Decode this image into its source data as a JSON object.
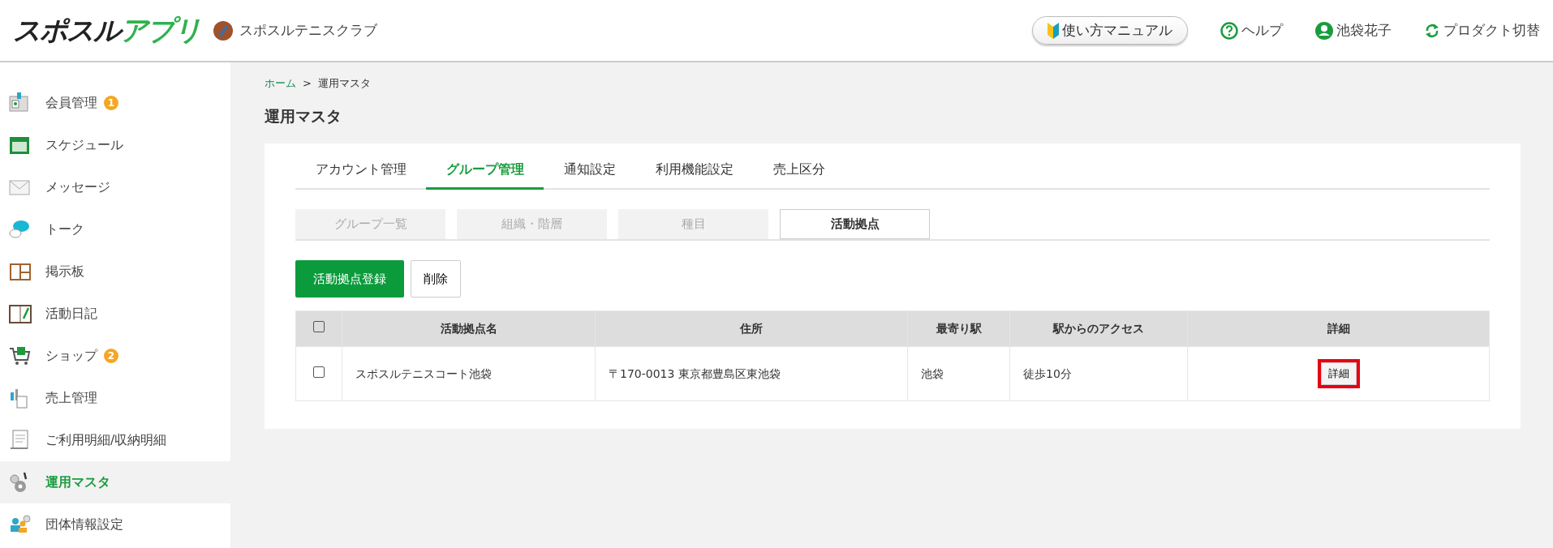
{
  "header": {
    "logo": {
      "dark": "スポスル",
      "accent": "アプリ"
    },
    "club_name": "スポスルテニスクラブ",
    "manual_button": "使い方マニュアル",
    "help": "ヘルプ",
    "user": "池袋花子",
    "switch": "プロダクト切替"
  },
  "sidebar": {
    "items": [
      {
        "label": "会員管理",
        "badge": "1",
        "selected": false
      },
      {
        "label": "スケジュール",
        "selected": false
      },
      {
        "label": "メッセージ",
        "selected": false
      },
      {
        "label": "トーク",
        "selected": false
      },
      {
        "label": "掲示板",
        "selected": false
      },
      {
        "label": "活動日記",
        "selected": false
      },
      {
        "label": "ショップ",
        "badge": "2",
        "selected": false
      },
      {
        "label": "売上管理",
        "selected": false
      },
      {
        "label": "ご利用明細/収納明細",
        "selected": false
      },
      {
        "label": "運用マスタ",
        "selected": true
      },
      {
        "label": "団体情報設定",
        "selected": false
      }
    ]
  },
  "breadcrumb": {
    "home": "ホーム",
    "separator": ">",
    "current": "運用マスタ"
  },
  "title": "運用マスタ",
  "tabs": [
    {
      "label": "アカウント管理",
      "selected": false
    },
    {
      "label": "グループ管理",
      "selected": true
    },
    {
      "label": "通知設定",
      "selected": false
    },
    {
      "label": "利用機能設定",
      "selected": false
    },
    {
      "label": "売上区分",
      "selected": false
    }
  ],
  "subtabs": [
    {
      "label": "グループ一覧",
      "selected": false
    },
    {
      "label": "組織・階層",
      "selected": false
    },
    {
      "label": "種目",
      "selected": false
    },
    {
      "label": "活動拠点",
      "selected": true
    }
  ],
  "buttons": {
    "register": "活動拠点登録",
    "delete": "削除"
  },
  "table": {
    "select_all_checked": false,
    "columns": [
      "活動拠点名",
      "住所",
      "最寄り駅",
      "駅からのアクセス",
      "詳細"
    ],
    "rows": [
      {
        "checked": false,
        "name": "スポスルテニスコート池袋",
        "address": "〒170-0013 東京都豊島区東池袋",
        "station": "池袋",
        "access": "徒歩10分",
        "detail": "詳細",
        "highlighted": true
      }
    ]
  }
}
